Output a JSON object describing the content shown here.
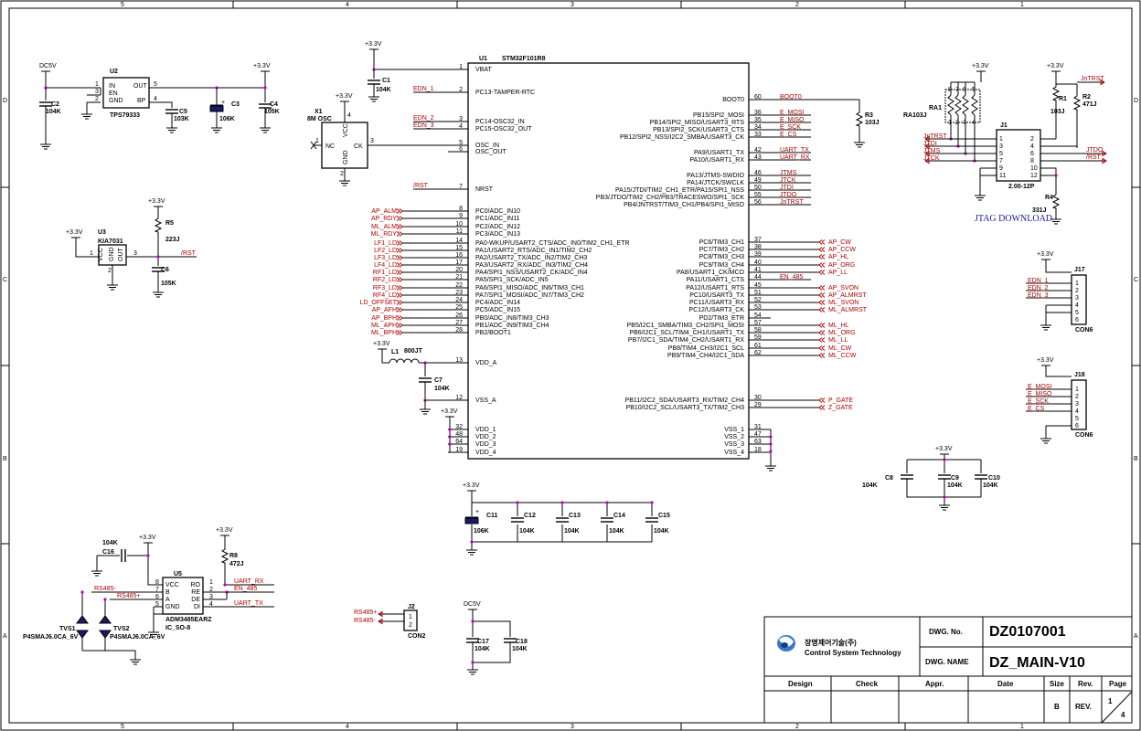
{
  "frame": {
    "col_top": [
      "5",
      "4",
      "3",
      "2",
      "1"
    ],
    "col_bottom": [
      "5",
      "4",
      "3",
      "2",
      "1"
    ],
    "rows_left": [
      "D",
      "C",
      "B",
      "A"
    ],
    "rows_right": [
      "D",
      "C",
      "B",
      "A"
    ]
  },
  "mcu": {
    "ref": "U1",
    "part": "STM32F101R8",
    "left_pins": [
      {
        "num": "1",
        "name": "VBAT"
      },
      {
        "num": "2",
        "name": "PC13-TAMPER-RTC"
      },
      {
        "num": "3",
        "name": "PC14-OSC32_IN"
      },
      {
        "num": "4",
        "name": "PC15-OSC32_OUT"
      },
      {
        "num": "5",
        "name": "OSC_IN"
      },
      {
        "num": "6",
        "name": "OSC_OUT"
      },
      {
        "num": "7",
        "name": "NRST"
      },
      {
        "num": "8",
        "name": "PC0/ADC_IN10"
      },
      {
        "num": "9",
        "name": "PC1/ADC_IN11"
      },
      {
        "num": "10",
        "name": "PC2/ADC_IN12"
      },
      {
        "num": "11",
        "name": "PC3/ADC_IN13"
      },
      {
        "num": "14",
        "name": "PA0-WKUP/USART2_CTS/ADC_IN0/TIM2_CH1_ETR"
      },
      {
        "num": "15",
        "name": "PA1/USART2_RTS/ADC_IN1/TIM2_CH2"
      },
      {
        "num": "16",
        "name": "PA2/USART2_TX/ADC_IN2/TIM2_CH3"
      },
      {
        "num": "17",
        "name": "PA3/USART2_RX/ADC_IN3/TIM2_CH4"
      },
      {
        "num": "20",
        "name": "PA4/SPI1_NSS/USART2_CK/ADC_IN4"
      },
      {
        "num": "21",
        "name": "PA5/SPI1_SCK/ADC_IN5"
      },
      {
        "num": "22",
        "name": "PA6/SPI1_MISO/ADC_IN6/TIM3_CH1"
      },
      {
        "num": "23",
        "name": "PA7/SPI1_MOSI/ADC_IN7/TIM3_CH2"
      },
      {
        "num": "24",
        "name": "PC4/ADC_IN14"
      },
      {
        "num": "25",
        "name": "PC5/ADC_IN15"
      },
      {
        "num": "26",
        "name": "PB0/ADC_IN8/TIM3_CH3"
      },
      {
        "num": "27",
        "name": "PB1/ADC_IN9/TIM3_CH4"
      },
      {
        "num": "28",
        "name": "PB2/BOOT1"
      },
      {
        "num": "13",
        "name": "VDD_A"
      },
      {
        "num": "12",
        "name": "VSS_A"
      },
      {
        "num": "32",
        "name": "VDD_1"
      },
      {
        "num": "48",
        "name": "VDD_2"
      },
      {
        "num": "64",
        "name": "VDD_3"
      },
      {
        "num": "19",
        "name": "VDD_4"
      }
    ],
    "left_nets": [
      {
        "pin": "2",
        "net": "EDN_1"
      },
      {
        "pin": "3",
        "net": "EDN_2"
      },
      {
        "pin": "4",
        "net": "EDN_3"
      },
      {
        "pin": "7",
        "net": "/RST"
      },
      {
        "pin": "8",
        "net": "AP_ALM"
      },
      {
        "pin": "9",
        "net": "AP_RDY"
      },
      {
        "pin": "10",
        "net": "ML_ALM"
      },
      {
        "pin": "11",
        "net": "ML_RDY"
      },
      {
        "pin": "14",
        "net": "LF1_LD"
      },
      {
        "pin": "15",
        "net": "LF2_LD"
      },
      {
        "pin": "16",
        "net": "LF3_LD"
      },
      {
        "pin": "17",
        "net": "LF4_LD"
      },
      {
        "pin": "20",
        "net": "RF1_LD"
      },
      {
        "pin": "21",
        "net": "RF2_LD"
      },
      {
        "pin": "22",
        "net": "RF3_LD"
      },
      {
        "pin": "23",
        "net": "RF4_LD"
      },
      {
        "pin": "24",
        "net": "LD_OFFSET"
      },
      {
        "pin": "25",
        "net": "AP_AFH"
      },
      {
        "pin": "26",
        "net": "AP_BPH"
      },
      {
        "pin": "27",
        "net": "ML_APH"
      },
      {
        "pin": "28",
        "net": "ML_BPH"
      }
    ],
    "right_pins": [
      {
        "num": "60",
        "name": "BOOT0",
        "net": "BOOT0"
      },
      {
        "num": "36",
        "name": "PB15/SPI2_MOSI",
        "net": "E_MOSI"
      },
      {
        "num": "35",
        "name": "PB14/SPI2_MISO/USART3_RTS",
        "net": "E_MISO"
      },
      {
        "num": "34",
        "name": "PB13/SPI2_SCK/USART3_CTS",
        "net": "E_SCK"
      },
      {
        "num": "33",
        "name": "PB12/SPI2_NSS/I2C2_SMBA/USART3_CK",
        "net": "E_CS"
      },
      {
        "num": "42",
        "name": "PA9/USART1_TX",
        "net": "UART_TX"
      },
      {
        "num": "43",
        "name": "PA10/USART1_RX",
        "net": "UART_RX"
      },
      {
        "num": "46",
        "name": "PA13/JTMS-SWDIO",
        "net": "JTMS"
      },
      {
        "num": "49",
        "name": "PA14/JTCK/SWCLK",
        "net": "JTCK"
      },
      {
        "num": "50",
        "name": "PA15/JTDI/TIM2_CH1_ETR/PA15/SPI1_NSS",
        "net": "JTDI"
      },
      {
        "num": "55",
        "name": "PB3/JTDO/TIM2_CH2/PB3/TRACESWO/SPI1_SCK",
        "net": "JTDO"
      },
      {
        "num": "56",
        "name": "PB4/JNTRST/TIM3_CH1/PB4/SPI1_MISO",
        "net": "JnTRST"
      },
      {
        "num": "37",
        "name": "PC6/TIM3_CH1",
        "net": "AP_CW"
      },
      {
        "num": "38",
        "name": "PC7/TIM3_CH2",
        "net": "AP_CCW"
      },
      {
        "num": "39",
        "name": "PC8/TIM3_CH3",
        "net": "AP_HL"
      },
      {
        "num": "40",
        "name": "PC9/TIM3_CH4",
        "net": "AP_ORG"
      },
      {
        "num": "41",
        "name": "PA8/USART1_CK/MCO",
        "net": "AP_LL"
      },
      {
        "num": "44",
        "name": "PA11/USART1_CTS",
        "net": "EN_485"
      },
      {
        "num": "45",
        "name": "PA12/USART1_RTS",
        "net": "AP_SVON"
      },
      {
        "num": "51",
        "name": "PC10/USART3_TX",
        "net": "AP_ALMRST"
      },
      {
        "num": "52",
        "name": "PC11/USART3_RX",
        "net": "ML_SVON"
      },
      {
        "num": "53",
        "name": "PC12/USART3_CK",
        "net": "ML_ALMRST"
      },
      {
        "num": "54",
        "name": "PD2/TIM3_ETR",
        "net": ""
      },
      {
        "num": "57",
        "name": "PB5/I2C1_SMBA/TIM3_CH2/SPI1_MOSI",
        "net": "ML_HL"
      },
      {
        "num": "58",
        "name": "PB6/I2C1_SCL/TIM4_CH1/USART1_TX",
        "net": "ML_ORG"
      },
      {
        "num": "59",
        "name": "PB7/I2C1_SDA/TIM4_CH2/USART1_RX",
        "net": "ML_LL"
      },
      {
        "num": "61",
        "name": "PB8/TIM4_CH3/I2C1_SCL",
        "net": "ML_CW"
      },
      {
        "num": "62",
        "name": "PB9/TIM4_CH4/I2C1_SDA",
        "net": "ML_CCW"
      },
      {
        "num": "30",
        "name": "PB11/I2C2_SDA/USART3_RX/TIM2_CH4",
        "net": "P_GATE"
      },
      {
        "num": "29",
        "name": "PB10/I2C2_SCL/USART3_TX/TIM2_CH3",
        "net": "Z_GATE"
      },
      {
        "num": "31",
        "name": "VSS_1",
        "net": ""
      },
      {
        "num": "47",
        "name": "VSS_2",
        "net": ""
      },
      {
        "num": "63",
        "name": "VSS_3",
        "net": ""
      },
      {
        "num": "18",
        "name": "VSS_4",
        "net": ""
      }
    ]
  },
  "regulator": {
    "ref": "U2",
    "part": "TPS79333",
    "in_net": "DC5V",
    "out_net": "+3.3V",
    "pins": [
      {
        "num": "1",
        "name": "IN"
      },
      {
        "num": "3",
        "name": "EN"
      },
      {
        "num": "2",
        "name": "GND"
      },
      {
        "num": "5",
        "name": "OUT"
      },
      {
        "num": "4",
        "name": "BP"
      }
    ],
    "caps": [
      {
        "ref": "C2",
        "val": "104K"
      },
      {
        "ref": "C5",
        "val": "103K"
      },
      {
        "ref": "C3",
        "val": "106K"
      },
      {
        "ref": "C4",
        "val": "105K"
      }
    ]
  },
  "reset": {
    "ref": "U3",
    "part": "KIA7031",
    "vcc": "+3.3V",
    "net": "/RST",
    "pins": [
      "1",
      "2",
      "3"
    ],
    "pin_names": [
      "VCC",
      "GND",
      "OUT"
    ],
    "r": {
      "ref": "R5",
      "val": "223J"
    },
    "c": {
      "ref": "C6",
      "val": "105K"
    }
  },
  "osc": {
    "ref": "X1",
    "part": "8M OSC",
    "vcc": "+3.3V",
    "pins": [
      "NC",
      "VCC",
      "GND",
      "CK"
    ],
    "pin_nums": [
      "1",
      "4",
      "2",
      "3"
    ],
    "vbat_net": "+3.3V",
    "c1": {
      "ref": "C1",
      "val": "104K"
    }
  },
  "boot": {
    "r": {
      "ref": "R3",
      "val": "103J"
    }
  },
  "vdda": {
    "vcc": "+3.3V",
    "l": {
      "ref": "L1",
      "val": "800JT"
    },
    "c": {
      "ref": "C7",
      "val": "104K"
    }
  },
  "vdd_net": "+3.3V",
  "jtag": {
    "vcc": "+3.3V",
    "ra": {
      "ref": "RA1",
      "val": "RA103J"
    },
    "ra_pins": [
      "1",
      "2",
      "3",
      "4",
      "5",
      "6",
      "7",
      "8"
    ],
    "r1": {
      "ref": "R1",
      "val": "103J"
    },
    "r2": {
      "ref": "R2",
      "val": "471J"
    },
    "r4": {
      "ref": "R4",
      "val": "331J"
    },
    "conn": {
      "ref": "J1",
      "part": "2.00-12P"
    },
    "left_nums": [
      "1",
      "3",
      "5",
      "7",
      "9",
      "11"
    ],
    "right_nums": [
      "2",
      "4",
      "6",
      "8",
      "10",
      "12"
    ],
    "left_nets": [
      "JnTRST",
      "JTDI",
      "JTMS",
      "JTCK"
    ],
    "top_net": "JnTRST",
    "right_nets": [
      "JTDO",
      "/RST"
    ],
    "caption": "JTAG DOWNLOAD"
  },
  "j17": {
    "ref": "J17",
    "part": "CON6",
    "vcc": "+3.3V",
    "nets": [
      "EDN_1",
      "EDN_2",
      "EDN_3"
    ],
    "pins": [
      "1",
      "2",
      "3",
      "4",
      "5",
      "6"
    ]
  },
  "j18": {
    "ref": "J18",
    "part": "CON6",
    "vcc": "+3.3V",
    "nets": [
      "E_MOSI",
      "E_MISO",
      "E_SCK",
      "E_CS"
    ],
    "pins": [
      "1",
      "2",
      "3",
      "4",
      "5",
      "6"
    ]
  },
  "decoupling1": {
    "vcc": "+3.3V",
    "caps": [
      {
        "ref": "C8",
        "val": "104K"
      },
      {
        "ref": "C9",
        "val": "104K"
      },
      {
        "ref": "C10",
        "val": "104K"
      }
    ]
  },
  "decoupling2": {
    "vcc": "+3.3V",
    "caps": [
      {
        "ref": "C11",
        "val": "106K"
      },
      {
        "ref": "C12",
        "val": "104K"
      },
      {
        "ref": "C13",
        "val": "104K"
      },
      {
        "ref": "C14",
        "val": "104K"
      },
      {
        "ref": "C15",
        "val": "104K"
      }
    ]
  },
  "rs485": {
    "ref": "U5",
    "part": "ADM3485EARZ",
    "pkg": "IC_SO-8",
    "vcc": "+3.3V",
    "left_pins": [
      {
        "num": "8",
        "name": "VCC"
      },
      {
        "num": "7",
        "name": "B"
      },
      {
        "num": "6",
        "name": "A"
      },
      {
        "num": "5",
        "name": "GND"
      }
    ],
    "right_pins": [
      {
        "num": "1",
        "name": "RO",
        "net": "UART_RX"
      },
      {
        "num": "2",
        "name": "RE",
        "net": "EN_485"
      },
      {
        "num": "3",
        "name": "DE",
        "net": ""
      },
      {
        "num": "4",
        "name": "DI",
        "net": "UART_TX"
      }
    ],
    "c16": {
      "ref": "C16",
      "val": "104K"
    },
    "r8": {
      "ref": "R8",
      "val": "472J"
    },
    "nets": [
      "RS485-",
      "RS485+"
    ],
    "tvs": [
      {
        "ref": "TVS1",
        "val": "P4SMAJ6.0CA_6V"
      },
      {
        "ref": "TVS2",
        "val": "P4SMAJ6.0CA_6V"
      }
    ]
  },
  "j2": {
    "ref": "J2",
    "part": "CON2",
    "nets": [
      "RS485+",
      "RS485-"
    ],
    "pins": [
      "1",
      "2"
    ]
  },
  "dc5v": {
    "net": "DC5V",
    "caps": [
      {
        "ref": "C17",
        "val": "104K"
      },
      {
        "ref": "C18",
        "val": "104K"
      }
    ]
  },
  "titleblock": {
    "company_kr": "장명제어기술(주)",
    "company_en": "Control System Technology",
    "dwg_no_label": "DWG. No.",
    "dwg_no": "DZ0107001",
    "dwg_name_label": "DWG. NAME",
    "dwg_name": "DZ_MAIN-V10",
    "headers": [
      "Design",
      "Check",
      "Appr.",
      "Date",
      "Size",
      "Rev.",
      "Page"
    ],
    "size": "B",
    "rev": "REV.",
    "page_num": "1",
    "page_total": "4"
  },
  "colors": {
    "wire": "#000000",
    "net_label": "#b00000",
    "junction": "#c000c0",
    "jtag_caption": "#1a1aa0"
  }
}
